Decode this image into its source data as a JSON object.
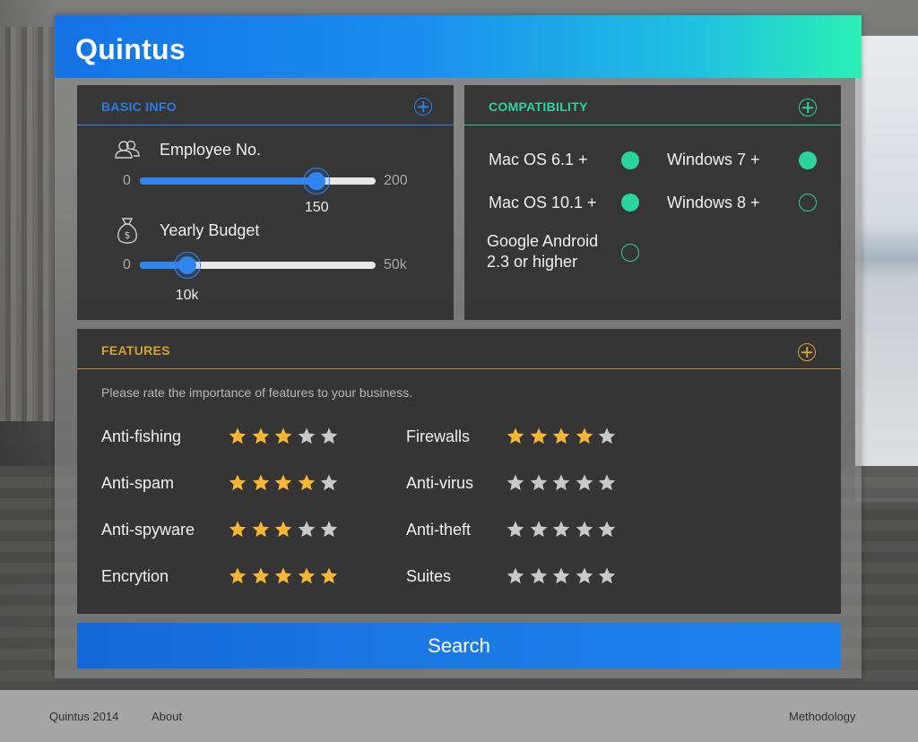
{
  "app": {
    "title": "Quintus"
  },
  "basic_info": {
    "title": "BASIC INFO",
    "employee": {
      "label": "Employee No.",
      "min": "0",
      "max": "200",
      "value": "150",
      "fraction": 0.75
    },
    "budget": {
      "label": "Yearly Budget",
      "min": "0",
      "max": "50k",
      "value": "10k",
      "fraction": 0.2
    }
  },
  "compatibility": {
    "title": "COMPATIBILITY",
    "options": [
      {
        "label": "Mac OS 6.1 +",
        "selected": true
      },
      {
        "label": "Windows 7 +",
        "selected": true
      },
      {
        "label": "Mac OS 10.1 +",
        "selected": true
      },
      {
        "label": "Windows 8 +",
        "selected": false
      },
      {
        "label": "Google Android 2.3 or higher",
        "selected": false
      }
    ]
  },
  "features": {
    "title": "FEATURES",
    "hint": "Please rate the importance of features to your business.",
    "items": [
      {
        "label": "Anti-fishing",
        "rating": 3
      },
      {
        "label": "Firewalls",
        "rating": 4
      },
      {
        "label": "Anti-spam",
        "rating": 4
      },
      {
        "label": "Anti-virus",
        "rating": 0
      },
      {
        "label": "Anti-spyware",
        "rating": 3
      },
      {
        "label": "Anti-theft",
        "rating": 0
      },
      {
        "label": "Encrytion",
        "rating": 5
      },
      {
        "label": "Suites",
        "rating": 0
      }
    ],
    "max_rating": 5
  },
  "search": {
    "label": "Search"
  },
  "footer": {
    "copyright": "Quintus 2014",
    "about": "About",
    "methodology": "Methodology"
  },
  "colors": {
    "accent_blue": "#2b7de9",
    "accent_green": "#2ad49e",
    "accent_gold": "#d6a22c",
    "star_on": "#f7b733",
    "star_off": "#c9c9c9"
  },
  "icons": {
    "employee": "people-icon",
    "budget": "money-bag-icon"
  }
}
